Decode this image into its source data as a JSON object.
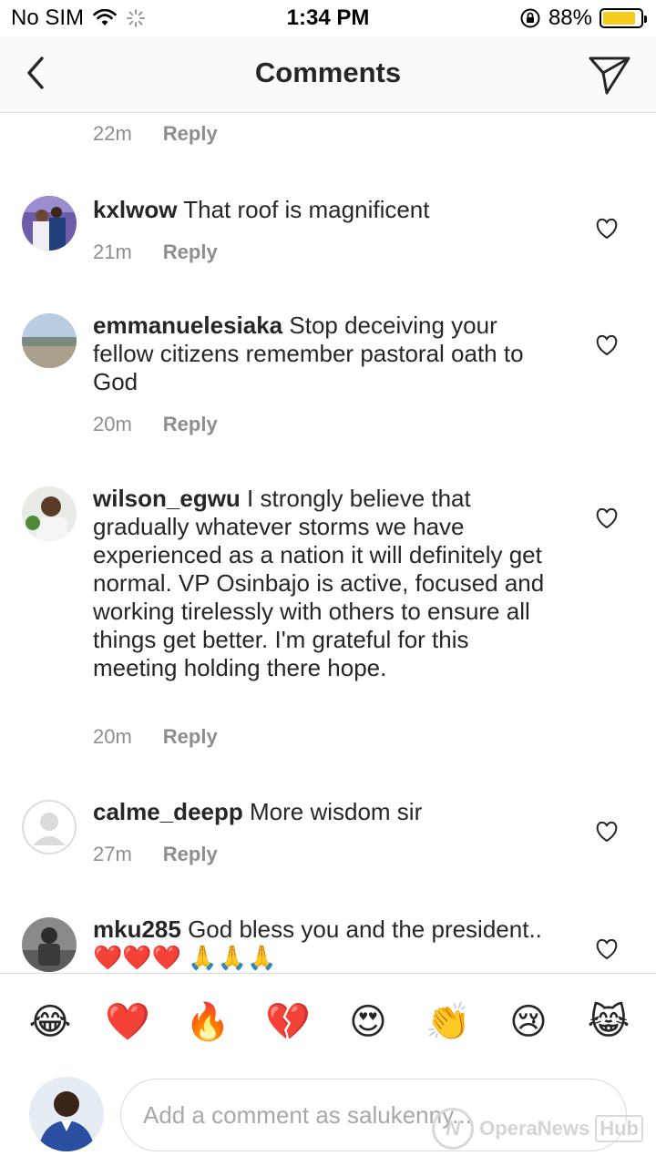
{
  "status_bar": {
    "carrier": "No SIM",
    "time": "1:34 PM",
    "battery_percent": "88%",
    "battery_level": 0.88,
    "battery_color": "#f6cc1f",
    "icons": [
      "wifi-icon",
      "loading-spinner-icon",
      "orientation-lock-icon",
      "battery-icon"
    ]
  },
  "header": {
    "title": "Comments",
    "back_icon": "chevron-left-icon",
    "send_icon": "paper-plane-icon"
  },
  "top_partial": {
    "time": "22m",
    "reply": "Reply"
  },
  "comments": [
    {
      "username": "kxlwow",
      "text": "That roof is magnificent",
      "time": "21m",
      "reply": "Reply"
    },
    {
      "username": "emmanuelesiaka",
      "text": "Stop deceiving your fellow citizens remember pastoral oath to God",
      "time": "20m",
      "reply": "Reply"
    },
    {
      "username": "wilson_egwu",
      "text": "I strongly believe that gradually whatever storms we have experienced as a nation it will definitely get normal. VP Osinbajo is active, focused and working tirelessly with others to ensure all things get better. I'm grateful for this meeting holding there hope.",
      "time": "20m",
      "reply": "Reply"
    },
    {
      "username": "calme_deepp",
      "text": "More wisdom sir",
      "time": "27m",
      "reply": "Reply"
    },
    {
      "username": "mku285",
      "text": "God bless you and the president.. ❤️❤️❤️ 🙏🙏🙏"
    }
  ],
  "emoji_bar": [
    "😂",
    "❤️",
    "🔥",
    "💔",
    "😍",
    "👏",
    "😢",
    "😹"
  ],
  "composer": {
    "placeholder": "Add a comment as salukenny...",
    "watermark": {
      "logo": "N",
      "brand": "OperaNews",
      "hub": "Hub"
    }
  },
  "colors": {
    "text": "#262626",
    "secondary": "#8e8e8e",
    "divider": "#dbdbdb",
    "heart_red": "#e0241f"
  }
}
